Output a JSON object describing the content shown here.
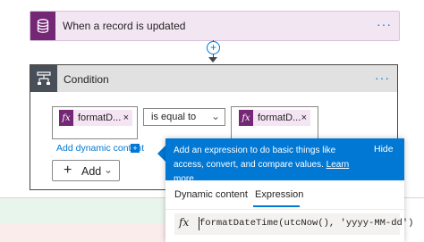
{
  "trigger": {
    "title": "When a record is updated",
    "menu_label": "···",
    "icon": "database-icon",
    "color": "#742774"
  },
  "connector": {
    "plus_label": "+"
  },
  "condition": {
    "title": "Condition",
    "menu_label": "···",
    "icon": "condition-icon",
    "left_token": {
      "label": "formatD...",
      "remove": "×"
    },
    "operator": "is equal to",
    "right_token": {
      "label": "formatD...",
      "remove": "×"
    },
    "add_dynamic_content": "Add dynamic content",
    "add_button": "Add"
  },
  "flyout": {
    "message": "Add an expression to do basic things like access, convert, and compare values.",
    "learn_more": "Learn more",
    "hide": "Hide",
    "tabs": [
      "Dynamic content",
      "Expression"
    ],
    "active_tab": "Expression",
    "expression": "formatDateTime(utcNow(), 'yyyy-MM-dd')",
    "accent": "#0078d4"
  }
}
